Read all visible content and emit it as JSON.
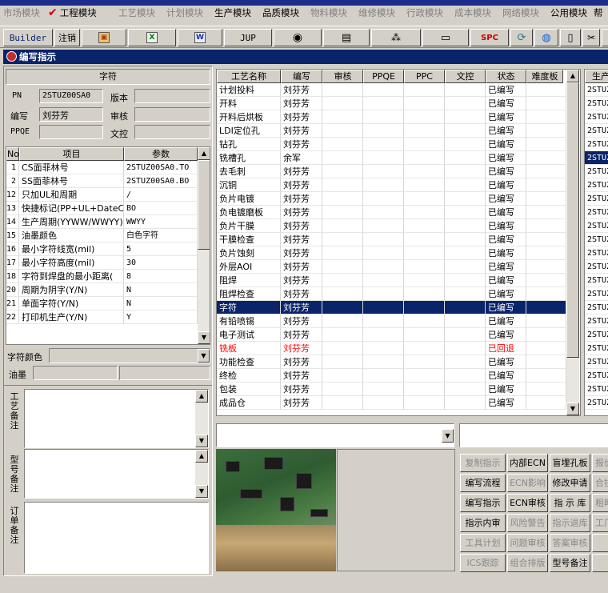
{
  "app_title": "",
  "menu": {
    "items": [
      {
        "label": "市场模块",
        "state": "disabled"
      },
      {
        "label": "工程模块",
        "state": "checked"
      },
      {
        "label": "工艺模块",
        "state": "disabled"
      },
      {
        "label": "计划模块",
        "state": "disabled"
      },
      {
        "label": "生产模块",
        "state": "enabled"
      },
      {
        "label": "品质模块",
        "state": "enabled"
      },
      {
        "label": "物料模块",
        "state": "disabled"
      },
      {
        "label": "维修模块",
        "state": "disabled"
      },
      {
        "label": "行政模块",
        "state": "disabled"
      },
      {
        "label": "成本模块",
        "state": "disabled"
      },
      {
        "label": "网络模块",
        "state": "disabled"
      },
      {
        "label": "公用模块",
        "state": "enabled"
      },
      {
        "label": "帮",
        "state": "enabled"
      }
    ]
  },
  "toolbar": {
    "builder_label": "Builder",
    "logout_label": "注销",
    "jup_label": "JUP",
    "spc_label": "SPC"
  },
  "window": {
    "title": "编写指示"
  },
  "spec": {
    "group_title": "字符",
    "pn_label": "PN",
    "pn_value": "2STUZ00SA0",
    "version_label": "版本",
    "version_value": "",
    "author_label": "编写",
    "author_value": "刘芬芳",
    "reviewer_label": "审核",
    "reviewer_value": "",
    "ppqe_label": "PPQE",
    "ppqe_value": "",
    "control_label": "文控",
    "control_value": ""
  },
  "params": {
    "headers": [
      "No",
      "项目",
      "参数"
    ],
    "rows": [
      {
        "no": "1",
        "item": "CS面菲林号",
        "value": "2STUZ00SA0.TO"
      },
      {
        "no": "2",
        "item": "SS面菲林号",
        "value": "2STUZ00SA0.BO"
      },
      {
        "no": "12",
        "item": "只加UL和周期",
        "value": "/"
      },
      {
        "no": "13",
        "item": "快捷标记(PP+UL+DateCo",
        "value": "BO"
      },
      {
        "no": "14",
        "item": "生产周期(YYWW/WWYY)",
        "value": "WWYY"
      },
      {
        "no": "15",
        "item": "油墨颜色",
        "value": "白色字符"
      },
      {
        "no": "16",
        "item": "最小字符线宽(mil)",
        "value": "5"
      },
      {
        "no": "17",
        "item": "最小字符高度(mil)",
        "value": "30"
      },
      {
        "no": "18",
        "item": "字符到焊盘的最小距离(",
        "value": "8"
      },
      {
        "no": "20",
        "item": "周期为阴字(Y/N)",
        "value": "N"
      },
      {
        "no": "21",
        "item": "单面字符(Y/N)",
        "value": "N"
      },
      {
        "no": "22",
        "item": "打印机生产(Y/N)",
        "value": "Y"
      }
    ]
  },
  "char_color": {
    "label": "字符颜色",
    "value": ""
  },
  "ink": {
    "label": "油墨",
    "value1": "",
    "value2": ""
  },
  "notes": {
    "process_label": "工艺备注",
    "model_label": "型号备注",
    "order_label": "订单备注"
  },
  "process": {
    "headers": [
      "工艺名称",
      "编写",
      "审核",
      "PPQE",
      "PPC",
      "文控",
      "状态",
      "难度板"
    ],
    "rows": [
      {
        "name": "计划投料",
        "author": "刘芬芳",
        "status": "已编写",
        "flag": ""
      },
      {
        "name": "开料",
        "author": "刘芬芳",
        "status": "已编写",
        "flag": ""
      },
      {
        "name": "开料后烘板",
        "author": "刘芬芳",
        "status": "已编写",
        "flag": ""
      },
      {
        "name": "LDI定位孔",
        "author": "刘芬芳",
        "status": "已编写",
        "flag": ""
      },
      {
        "name": "钻孔",
        "author": "刘芬芳",
        "status": "已编写",
        "flag": ""
      },
      {
        "name": "铣槽孔",
        "author": "余军",
        "status": "已编写",
        "flag": ""
      },
      {
        "name": "去毛刺",
        "author": "刘芬芳",
        "status": "已编写",
        "flag": ""
      },
      {
        "name": "沉铜",
        "author": "刘芬芳",
        "status": "已编写",
        "flag": ""
      },
      {
        "name": "负片电镀",
        "author": "刘芬芳",
        "status": "已编写",
        "flag": ""
      },
      {
        "name": "负电镀磨板",
        "author": "刘芬芳",
        "status": "已编写",
        "flag": ""
      },
      {
        "name": "负片干膜",
        "author": "刘芬芳",
        "status": "已编写",
        "flag": ""
      },
      {
        "name": "干膜检查",
        "author": "刘芬芳",
        "status": "已编写",
        "flag": ""
      },
      {
        "name": "负片蚀刻",
        "author": "刘芬芳",
        "status": "已编写",
        "flag": ""
      },
      {
        "name": "外层AOI",
        "author": "刘芬芳",
        "status": "已编写",
        "flag": ""
      },
      {
        "name": "阻焊",
        "author": "刘芬芳",
        "status": "已编写",
        "flag": ""
      },
      {
        "name": "阻焊检查",
        "author": "刘芬芳",
        "status": "已编写",
        "flag": ""
      },
      {
        "name": "字符",
        "author": "刘芬芳",
        "status": "已编写",
        "flag": "selected"
      },
      {
        "name": "有铅喷锡",
        "author": "刘芬芳",
        "status": "已编写",
        "flag": ""
      },
      {
        "name": "电子测试",
        "author": "刘芬芳",
        "status": "已编写",
        "flag": ""
      },
      {
        "name": "铣板",
        "author": "刘芬芳",
        "status": "已回退",
        "flag": "red"
      },
      {
        "name": "功能检查",
        "author": "刘芬芳",
        "status": "已编写",
        "flag": ""
      },
      {
        "name": "终检",
        "author": "刘芬芳",
        "status": "已编写",
        "flag": ""
      },
      {
        "name": "包装",
        "author": "刘芬芳",
        "status": "已编写",
        "flag": ""
      },
      {
        "name": "成品仓",
        "author": "刘芬芳",
        "status": "已编写",
        "flag": ""
      }
    ]
  },
  "side_list": {
    "header": "生产",
    "items": [
      "2STUZ",
      "2STUZ",
      "2STUZ",
      "2STUZ",
      "2STUZ",
      "2STUZ",
      "2STUZ",
      "2STUZ",
      "2STUZ",
      "2STUZ",
      "2STUZ",
      "2STUZ",
      "2STUZ",
      "2STUZ",
      "2STUZ",
      "2STUZ",
      "2STUZ",
      "2STUZ",
      "2STUZ",
      "2STUZ",
      "2STUZ",
      "2STUZ",
      "2STUZ",
      "2STUZ"
    ]
  },
  "actions": [
    [
      {
        "label": "复制指示",
        "enabled": false
      },
      {
        "label": "内部ECN",
        "enabled": true
      },
      {
        "label": "盲埋孔板",
        "enabled": true
      },
      {
        "label": "报价",
        "enabled": false
      }
    ],
    [
      {
        "label": "编写流程",
        "enabled": true
      },
      {
        "label": "ECN影响",
        "enabled": false
      },
      {
        "label": "修改申请",
        "enabled": true
      },
      {
        "label": "合拼",
        "enabled": false
      }
    ],
    [
      {
        "label": "编写指示",
        "enabled": true
      },
      {
        "label": "ECN审核",
        "enabled": true
      },
      {
        "label": "指 示 库",
        "enabled": true
      },
      {
        "label": "粗略",
        "enabled": false
      }
    ],
    [
      {
        "label": "指示内审",
        "enabled": true
      },
      {
        "label": "风险警告",
        "enabled": false
      },
      {
        "label": "指示退库",
        "enabled": false
      },
      {
        "label": "工厂",
        "enabled": false
      }
    ],
    [
      {
        "label": "工具计划",
        "enabled": false
      },
      {
        "label": "问题审核",
        "enabled": false
      },
      {
        "label": "答案审核",
        "enabled": false
      },
      {
        "label": "",
        "enabled": false
      }
    ],
    [
      {
        "label": "ICS跟踪",
        "enabled": false
      },
      {
        "label": "组合排版",
        "enabled": false
      },
      {
        "label": "型号备注",
        "enabled": true
      },
      {
        "label": "",
        "enabled": false
      }
    ]
  ]
}
